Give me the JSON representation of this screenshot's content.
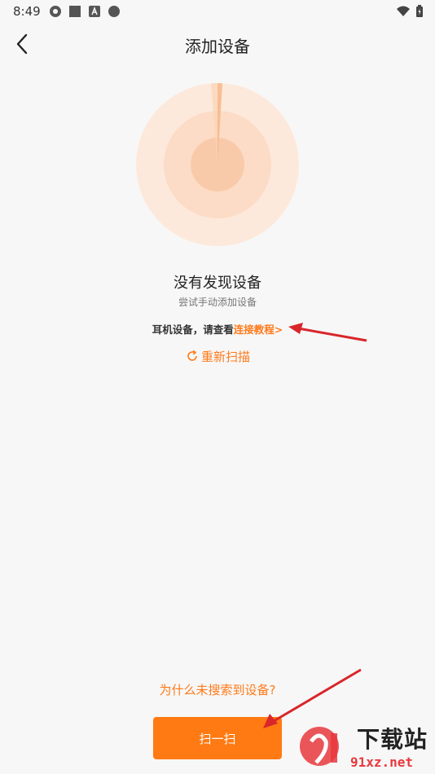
{
  "status_bar": {
    "time": "8:49"
  },
  "header": {
    "title": "添加设备"
  },
  "result": {
    "title": "没有发现设备",
    "subtitle": "尝试手动添加设备",
    "earphone_prefix": "耳机设备，请查看",
    "earphone_link": "连接教程>",
    "rescan_label": "重新扫描"
  },
  "footer": {
    "why_label": "为什么未搜索到设备?",
    "scan_button_label": "扫一扫"
  },
  "watermark": {
    "logo_text": "下载站",
    "url_text": "91xz.net"
  },
  "colors": {
    "accent": "#ff7a12",
    "radar_outer": "#fde6d6",
    "radar_mid": "#fcd9c2",
    "radar_inner": "#f9c7a6"
  }
}
